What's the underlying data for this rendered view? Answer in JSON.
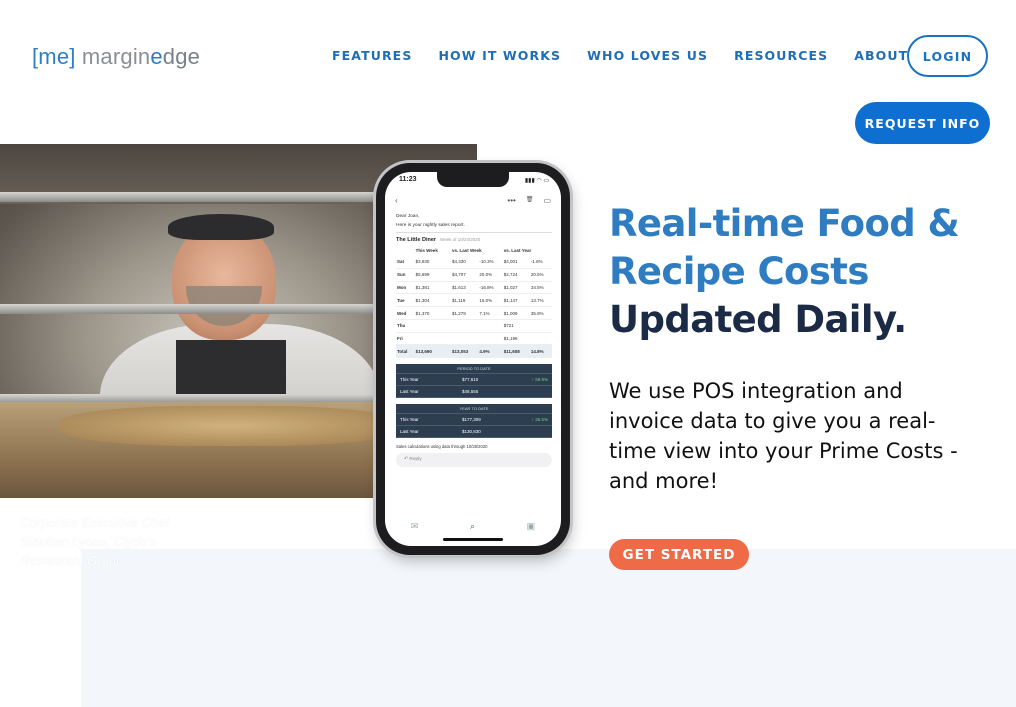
{
  "header": {
    "logo": {
      "bracket": "[me]",
      "text_a": "margin",
      "text_e": "e",
      "text_b": "dge"
    },
    "nav": [
      "FEATURES",
      "HOW IT WORKS",
      "WHO LOVES US",
      "RESOURCES",
      "ABOUT [ME]"
    ],
    "login_label": "LOGIN",
    "request_label": "REQUEST INFO"
  },
  "photo": {
    "caption": "Corporate Executive Chef Stephen Lyons, Clyde's Restaurant Group"
  },
  "phone": {
    "time": "11:23",
    "status_icons": "▮▮▮ ◠ ▭",
    "toolbar": {
      "back": "‹",
      "more": "•••",
      "trash": "🗑",
      "archive": "▭"
    },
    "greeting": "Dear Joan,",
    "intro": "Here is your nightly sales report.",
    "report_title": "The Little Diner",
    "report_week": "Week of 10/24/2020",
    "columns": [
      "",
      "This Week",
      "vs. Last Week",
      "",
      "vs. Last Year",
      ""
    ],
    "rows": [
      {
        "day": "Sat",
        "this": "$3,930",
        "lw": "$4,330",
        "lw_pct": "-10.3%",
        "ly": "$4,001",
        "ly_pct": "-1.8%"
      },
      {
        "day": "Sun",
        "this": "$5,699",
        "lw": "$4,707",
        "lw_pct": "20.0%",
        "ly": "$4,724",
        "ly_pct": "20.5%"
      },
      {
        "day": "Mon",
        "this": "$1,381",
        "lw": "$1,613",
        "lw_pct": "-16.8%",
        "ly": "$1,027",
        "ly_pct": "34.5%"
      },
      {
        "day": "Tue",
        "this": "$1,304",
        "lw": "$1,119",
        "lw_pct": "16.0%",
        "ly": "$1,147",
        "ly_pct": "13.7%"
      },
      {
        "day": "Wed",
        "this": "$1,370",
        "lw": "$1,279",
        "lw_pct": "7.1%",
        "ly": "$1,009",
        "ly_pct": "35.8%"
      },
      {
        "day": "Thu",
        "this": "",
        "lw": "",
        "lw_pct": "",
        "ly": "$721",
        "ly_pct": ""
      },
      {
        "day": "Fri",
        "this": "",
        "lw": "",
        "lw_pct": "",
        "ly": "$1,196",
        "ly_pct": ""
      },
      {
        "day": "Total",
        "this": "$13,690",
        "lw": "$13,053",
        "lw_pct": "4.9%",
        "ly": "$11,608",
        "ly_pct": "14.8%"
      }
    ],
    "period": {
      "header": "PERIOD TO DATE",
      "this_label": "This Year",
      "this_val": "$77,610",
      "pct": "↑ 59.9%",
      "last_label": "Last Year",
      "last_val": "$48,555"
    },
    "ytd": {
      "header": "YEAR TO DATE",
      "this_label": "This Year",
      "this_val": "$177,309",
      "pct": "↑ 35.5%",
      "last_label": "Last Year",
      "last_val": "$130,830"
    },
    "footnote": "Sales calculations using data through 10/28/2020",
    "reply": "Reply",
    "tabs": [
      "✉",
      "⌕",
      "▣"
    ]
  },
  "hero": {
    "headline_blue_1": "Real-time Food &",
    "headline_blue_2": "Recipe Costs",
    "headline_dark": "Updated Daily.",
    "body": "We use POS integration and invoice data to give you a real-time view into your Prime Costs - and more!",
    "cta_label": "GET STARTED"
  },
  "colors": {
    "brand_blue": "#1b72c2",
    "headline_blue": "#2f7cc1",
    "navy": "#1b2a45",
    "cta_orange": "#ef6a46"
  }
}
